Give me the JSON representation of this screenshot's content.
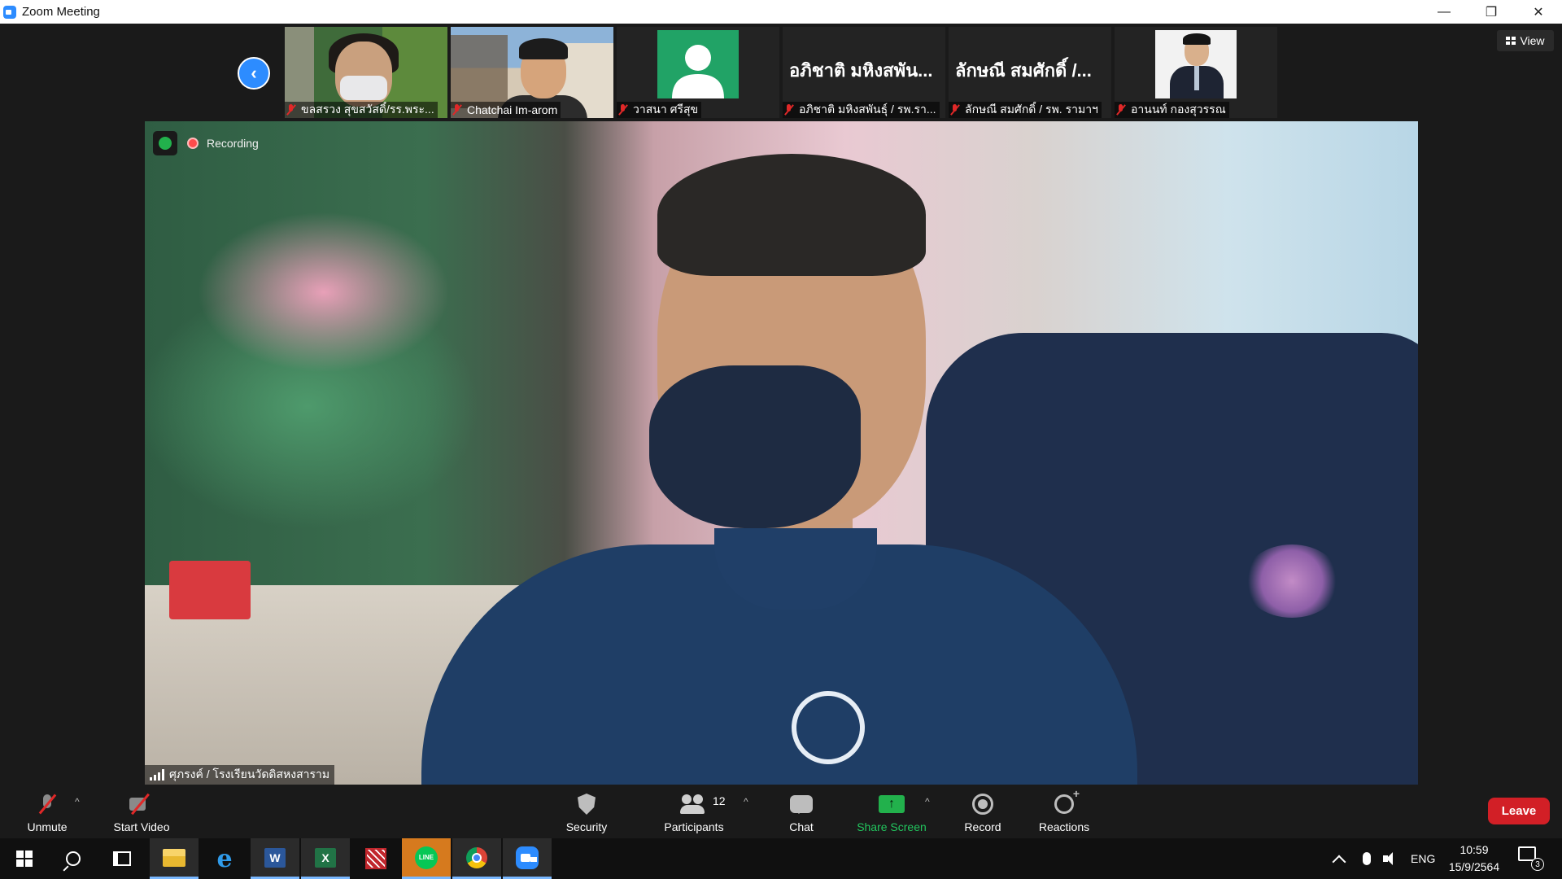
{
  "window": {
    "title": "Zoom Meeting",
    "minimize": "—",
    "maximize": "❐",
    "close": "✕"
  },
  "gallery": {
    "prev_icon": "chevron-left-icon",
    "view_label": "View",
    "tiles": [
      {
        "name": "ขลสรวง  สุขสวัสดิ์/รร.พระ...",
        "video": true,
        "muted": true
      },
      {
        "name": "Chatchai Im-arom",
        "video": true,
        "muted": true
      },
      {
        "name": "วาสนา ศรีสุข",
        "video": false,
        "muted": true
      },
      {
        "display_name": "อภิชาติ มหิงสพัน...",
        "name": "อภิชาติ มหิงสพันธุ์ / รพ.รา...",
        "video": false,
        "muted": true
      },
      {
        "display_name": "ลักษณี สมศักดิ์ /...",
        "name": "ลักษณี สมศักดิ์ / รพ. รามาฯ",
        "video": false,
        "muted": true
      },
      {
        "name": "อานนท์ กองสุวรรณ",
        "video": true,
        "muted": true
      }
    ]
  },
  "main_video": {
    "recording_label": "Recording",
    "speaker_name": "ศุภรงค์ / โรงเรียนวัดดิสหงสาราม"
  },
  "controls": {
    "unmute": "Unmute",
    "start_video": "Start Video",
    "security": "Security",
    "participants": "Participants",
    "participant_count": "12",
    "chat": "Chat",
    "share_screen": "Share Screen",
    "share_arrow": "↑",
    "record": "Record",
    "reactions": "Reactions",
    "leave": "Leave",
    "caret": "^"
  },
  "taskbar": {
    "apps": [
      "windows-start",
      "search",
      "task-view",
      "file-explorer",
      "internet-explorer",
      "word",
      "excel",
      "qr-app",
      "line",
      "chrome",
      "zoom"
    ],
    "word_letter": "W",
    "excel_letter": "X",
    "ie_letter": "e",
    "line_text": "LINE",
    "language": "ENG",
    "time": "10:59",
    "date": "15/9/2564",
    "notification_count": "3"
  },
  "colors": {
    "zoom_blue": "#2d8cff",
    "leave_red": "#d21f26",
    "share_green": "#22b14c",
    "muted_red": "#e02828"
  }
}
